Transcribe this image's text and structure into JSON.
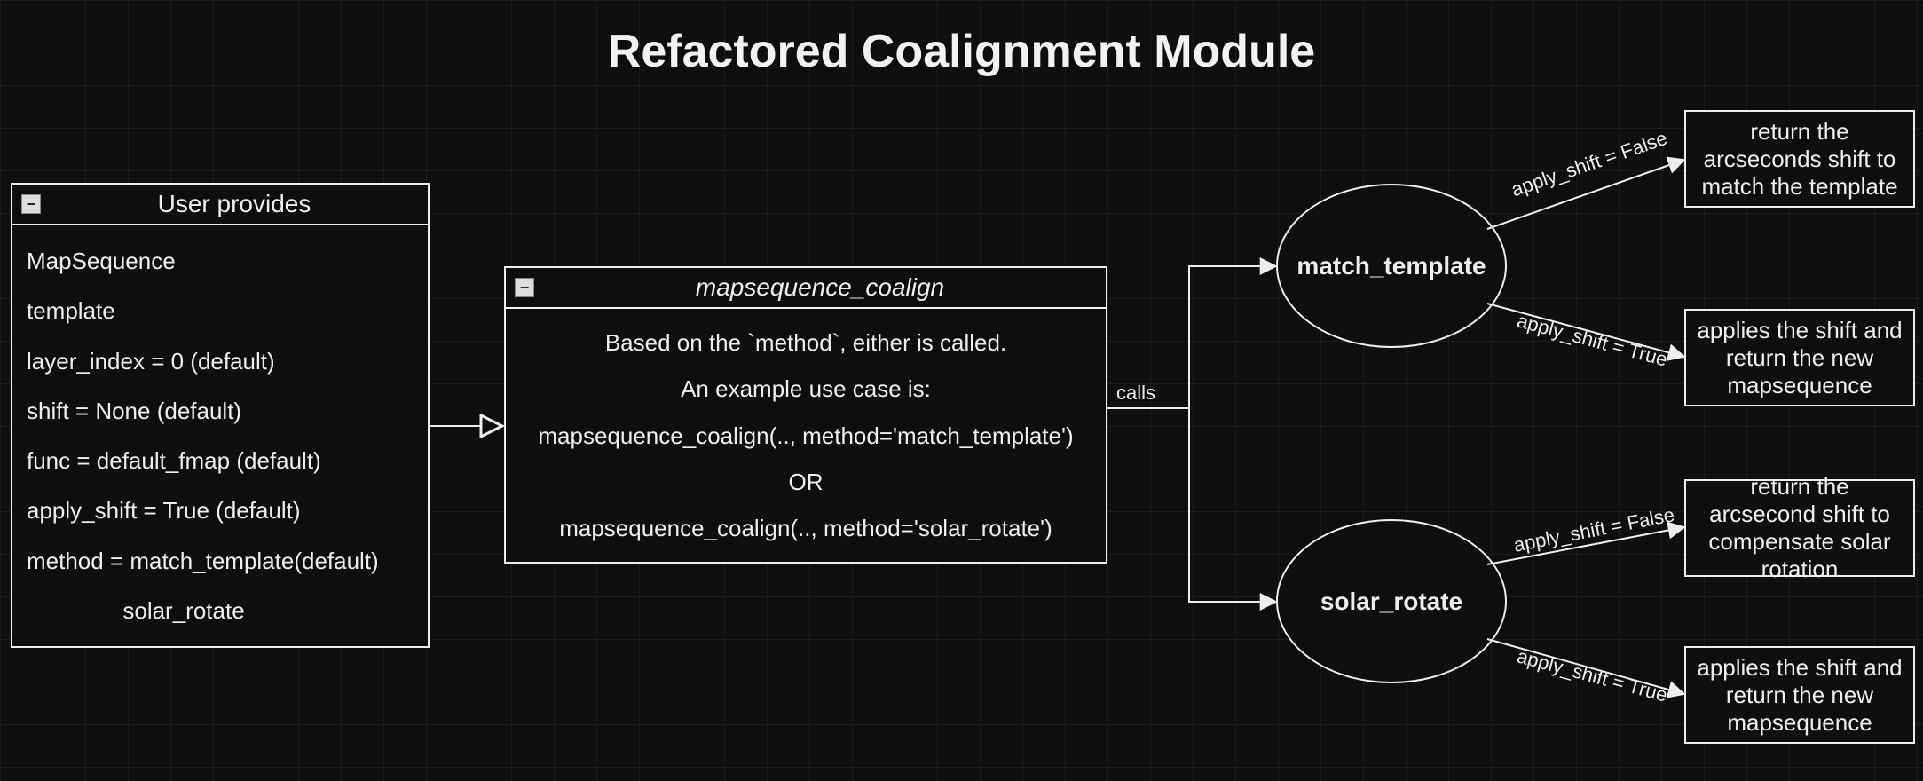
{
  "title": "Refactored Coalignment Module",
  "user_box": {
    "header": "User provides",
    "items": [
      "MapSequence",
      "template",
      "layer_index = 0 (default)",
      "shift = None (default)",
      "func = default_fmap (default)",
      "apply_shift = True (default)",
      "method = match_template(default)",
      "               solar_rotate"
    ]
  },
  "func_box": {
    "header": "mapsequence_coalign",
    "lines": [
      "Based on the `method`, either is called.",
      "An example use case is:",
      "mapsequence_coalign(.., method='match_template')",
      "OR",
      "mapsequence_coalign(.., method='solar_rotate')"
    ]
  },
  "edge_labels": {
    "calls": "calls",
    "apply_shift_false": "apply_shift = False",
    "apply_shift_true": "apply_shift = True"
  },
  "ellipses": {
    "match_template": "match_template",
    "solar_rotate": "solar_rotate"
  },
  "terminals": {
    "mt_false": "return the arcseconds shift to match the template",
    "mt_true": "applies the shift and return the new mapsequence",
    "sr_false": "return the arcsecond shift to compensate solar rotation",
    "sr_true": "applies the shift and return the new mapsequence"
  },
  "collapse_glyph": "−"
}
